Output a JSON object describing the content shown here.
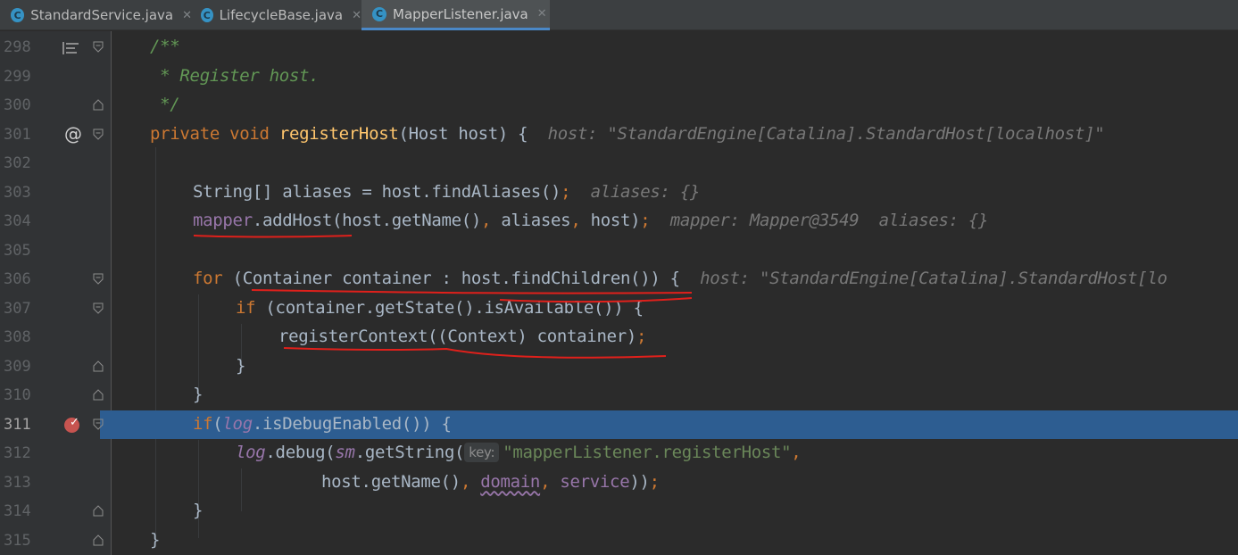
{
  "tabs": [
    {
      "label": "StandardService.java",
      "icon": "class-icon",
      "letter": "C",
      "active": false
    },
    {
      "label": "LifecycleBase.java",
      "icon": "class-icon",
      "letter": "C",
      "active": false
    },
    {
      "label": "MapperListener.java",
      "icon": "class-icon",
      "letter": "C",
      "active": true
    }
  ],
  "lines": [
    "298",
    "299",
    "300",
    "301",
    "302",
    "303",
    "304",
    "305",
    "306",
    "307",
    "308",
    "309",
    "310",
    "311",
    "312",
    "313",
    "314",
    "315"
  ],
  "code": {
    "l298": "/**",
    "l299": " * Register host.",
    "l300": " */",
    "l301_kw": "private void ",
    "l301_fn": "registerHost",
    "l301_rest": "(Host host) {",
    "l301_hint": "host: \"StandardEngine[Catalina].StandardHost[localhost]\"",
    "l303_code": "String[] aliases = host.findAliases()",
    "l303_semi": ";",
    "l303_hint": "aliases: {}",
    "l304_field": "mapper",
    "l304_a": ".addHost(host.getName()",
    "l304_c1": ",",
    "l304_b": " aliases",
    "l304_c2": ",",
    "l304_c": " host)",
    "l304_semi": ";",
    "l304_hint": "mapper: Mapper@3549  aliases: {}",
    "l306_kw": "for ",
    "l306_rest": "(Container container : host.findChildren()) {",
    "l306_hint": "host: \"StandardEngine[Catalina].StandardHost[lo",
    "l307_kw": "if ",
    "l307_rest": "(container.getState().isAvailable()) {",
    "l308_code": "registerContext((Context) container)",
    "l308_semi": ";",
    "l309": "}",
    "l310": "}",
    "l311_kw": "if",
    "l311_a": "(",
    "l311_log": "log",
    "l311_b": ".isDebugEnabled()) {",
    "l312_log": "log",
    "l312_a": ".debug(",
    "l312_sm": "sm",
    "l312_b": ".getString(",
    "l312_param": "key:",
    "l312_str": "\"mapperListener.registerHost\"",
    "l312_comma": ",",
    "l313_a": "host.getName()",
    "l313_c1": ", ",
    "l313_domain": "domain",
    "l313_c2": ", ",
    "l313_service": "service",
    "l313_b": "))",
    "l313_semi": ";",
    "l314": "}",
    "l315": "}"
  },
  "colors": {
    "background": "#2b2b2b",
    "keyword": "#cc7832",
    "comment": "#629755",
    "method_decl": "#ffc66d",
    "field": "#9876aa",
    "string": "#6a8759",
    "current_line": "#2d5d91",
    "breakpoint": "#c75450",
    "annotation_marks": "#e0201b"
  }
}
